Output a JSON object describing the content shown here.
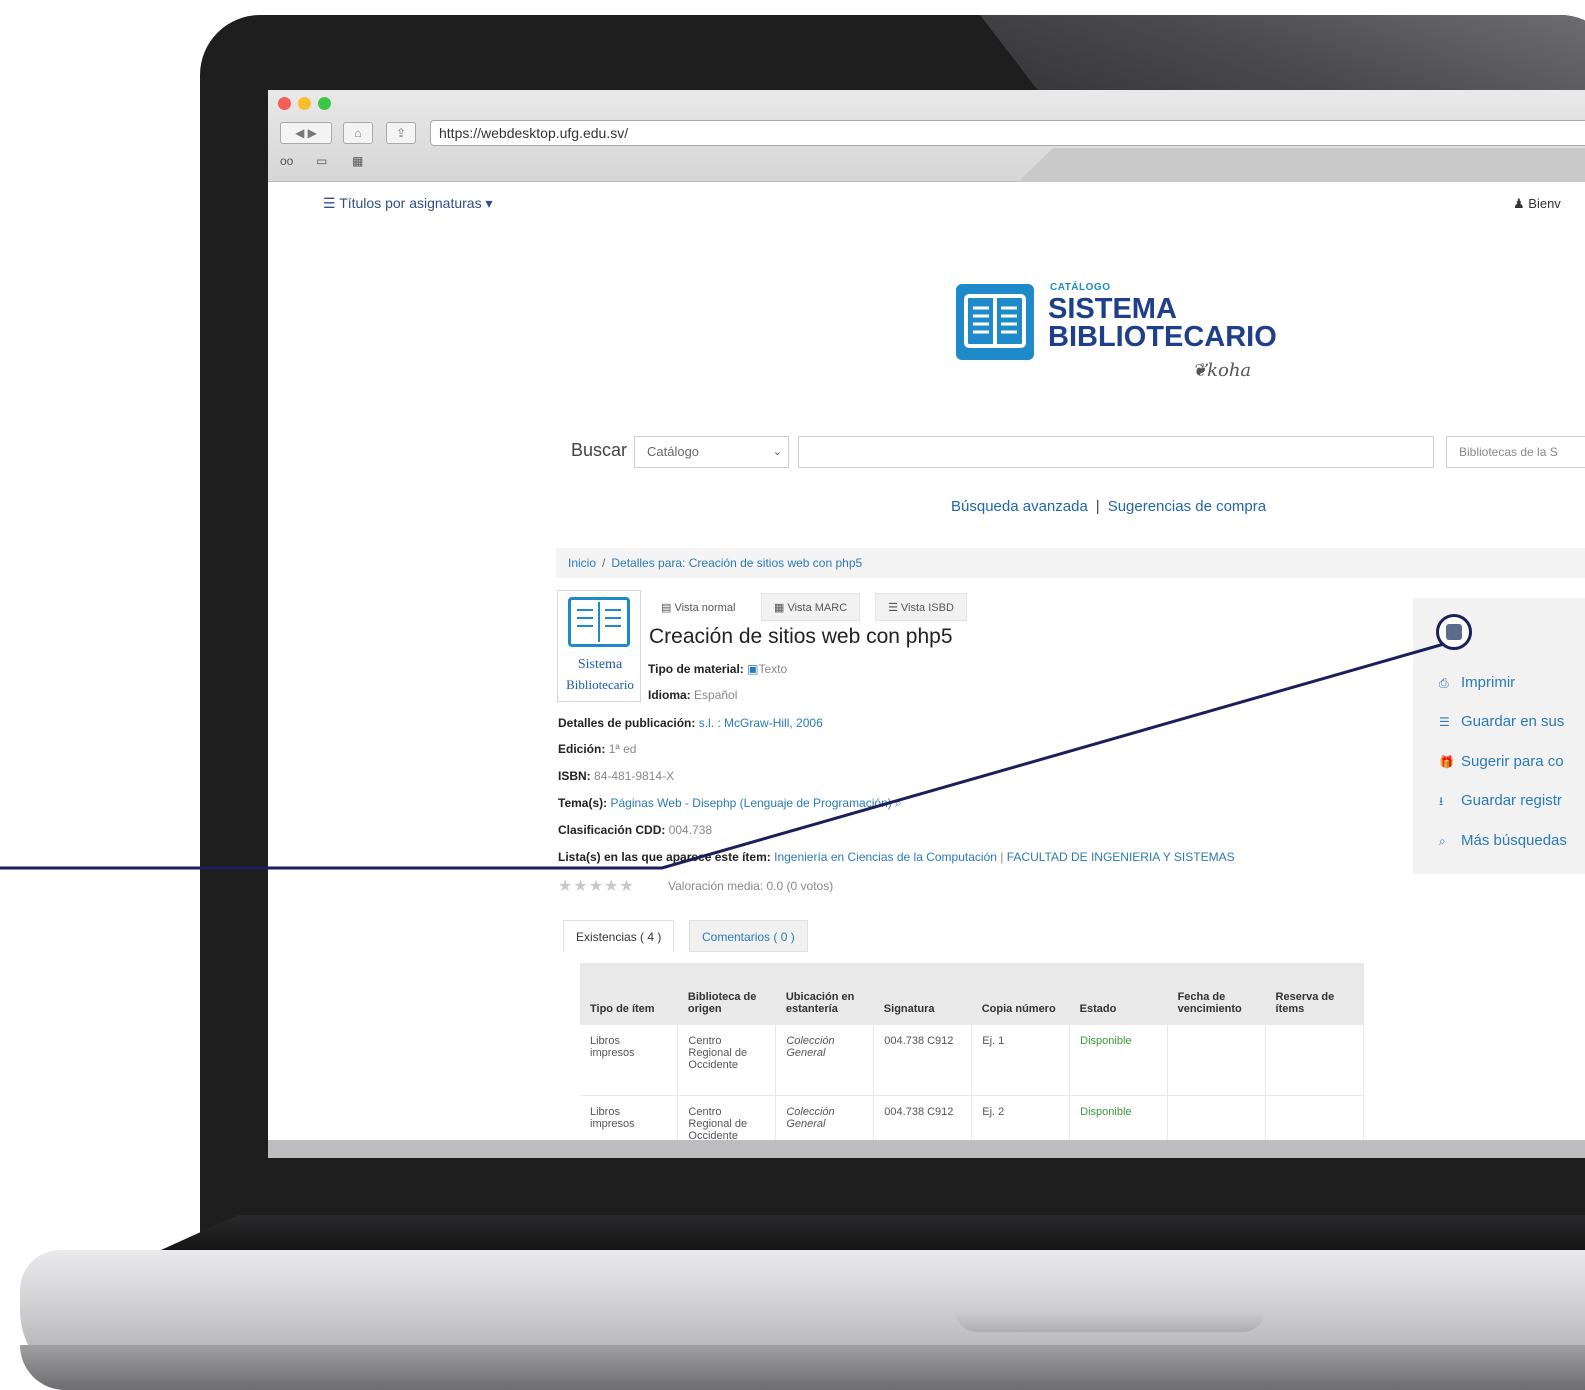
{
  "browser": {
    "url": "https://webdesktop.ufg.edu.sv/"
  },
  "topnav": {
    "menu_label": "Títulos por asignaturas",
    "welcome": "Bienv"
  },
  "logo": {
    "small": "CATÁLOGO",
    "line1": "SISTEMA",
    "line2": "BIBLIOTECARIO",
    "koha": "koha"
  },
  "search": {
    "label": "Buscar",
    "scope": "Catálogo",
    "library": "Bibliotecas de la S"
  },
  "links": {
    "advanced": "Búsqueda avanzada",
    "separator": "|",
    "suggestions": "Sugerencias de compra"
  },
  "breadcrumb": {
    "home": "Inicio",
    "separator": "/",
    "current": "Detalles para: Creación de sitios web con php5"
  },
  "cover": {
    "line1": "Sistema",
    "line2": "Bibliotecario"
  },
  "view_tabs": [
    "Vista normal",
    "Vista MARC",
    "Vista ISBD"
  ],
  "record": {
    "title": "Creación de sitios web con php5",
    "material_label": "Tipo de material:",
    "material_value": "Texto",
    "language_label": "Idioma:",
    "language_value": "Español",
    "publication_label": "Detalles de publicación:",
    "publication_value": "s.l. : McGraw-Hill, 2006",
    "edition_label": "Edición:",
    "edition_value": "1ª ed",
    "isbn_label": "ISBN:",
    "isbn_value": "84-481-9814-X",
    "subject_label": "Tema(s):",
    "subject_value": "Páginas Web - Disephp (Lenguaje de Programación)",
    "class_label": "Clasificación CDD:",
    "class_value": "004.738",
    "lists_label": "Lista(s) en las que aparece este ítem:",
    "lists_value1": "Ingeniería en Ciencias de la Computación",
    "lists_sep": "|",
    "lists_value2": "FACULTAD DE INGENIERIA Y SISTEMAS",
    "rating": "Valoración media: 0.0 (0 votos)",
    "stars": "★★★★★"
  },
  "holdings_tabs": [
    "Existencias ( 4 )",
    "Comentarios ( 0 )"
  ],
  "holdings": {
    "headers": [
      "Tipo de ítem",
      "Biblioteca de origen",
      "Ubicación en estantería",
      "Signatura",
      "Copia número",
      "Estado",
      "Fecha de vencimiento",
      "Reserva de ítems"
    ],
    "rows": [
      [
        "Libros impresos",
        "Centro Regional de Occidente",
        "Colección General",
        "004.738 C912",
        "Ej. 1",
        "Disponible",
        "",
        ""
      ],
      [
        "Libros impresos",
        "Centro Regional de Occidente",
        "Colección General",
        "004.738 C912",
        "Ej. 2",
        "Disponible",
        "",
        ""
      ]
    ]
  },
  "sidebar": {
    "items": [
      {
        "icon": "print-icon",
        "label": "Imprimir"
      },
      {
        "icon": "list-icon",
        "label": "Guardar en sus"
      },
      {
        "icon": "gift-icon",
        "label": "Sugerir para co"
      },
      {
        "icon": "download-icon",
        "label": "Guardar registr"
      },
      {
        "icon": "search-icon",
        "label": "Más búsquedas"
      }
    ]
  },
  "colors": {
    "link": "#2a7ab8",
    "brand_blue": "#1e8ac9",
    "brand_navy": "#1f3f8a",
    "callout": "#1b1f5a",
    "available": "#3a9a3a"
  }
}
